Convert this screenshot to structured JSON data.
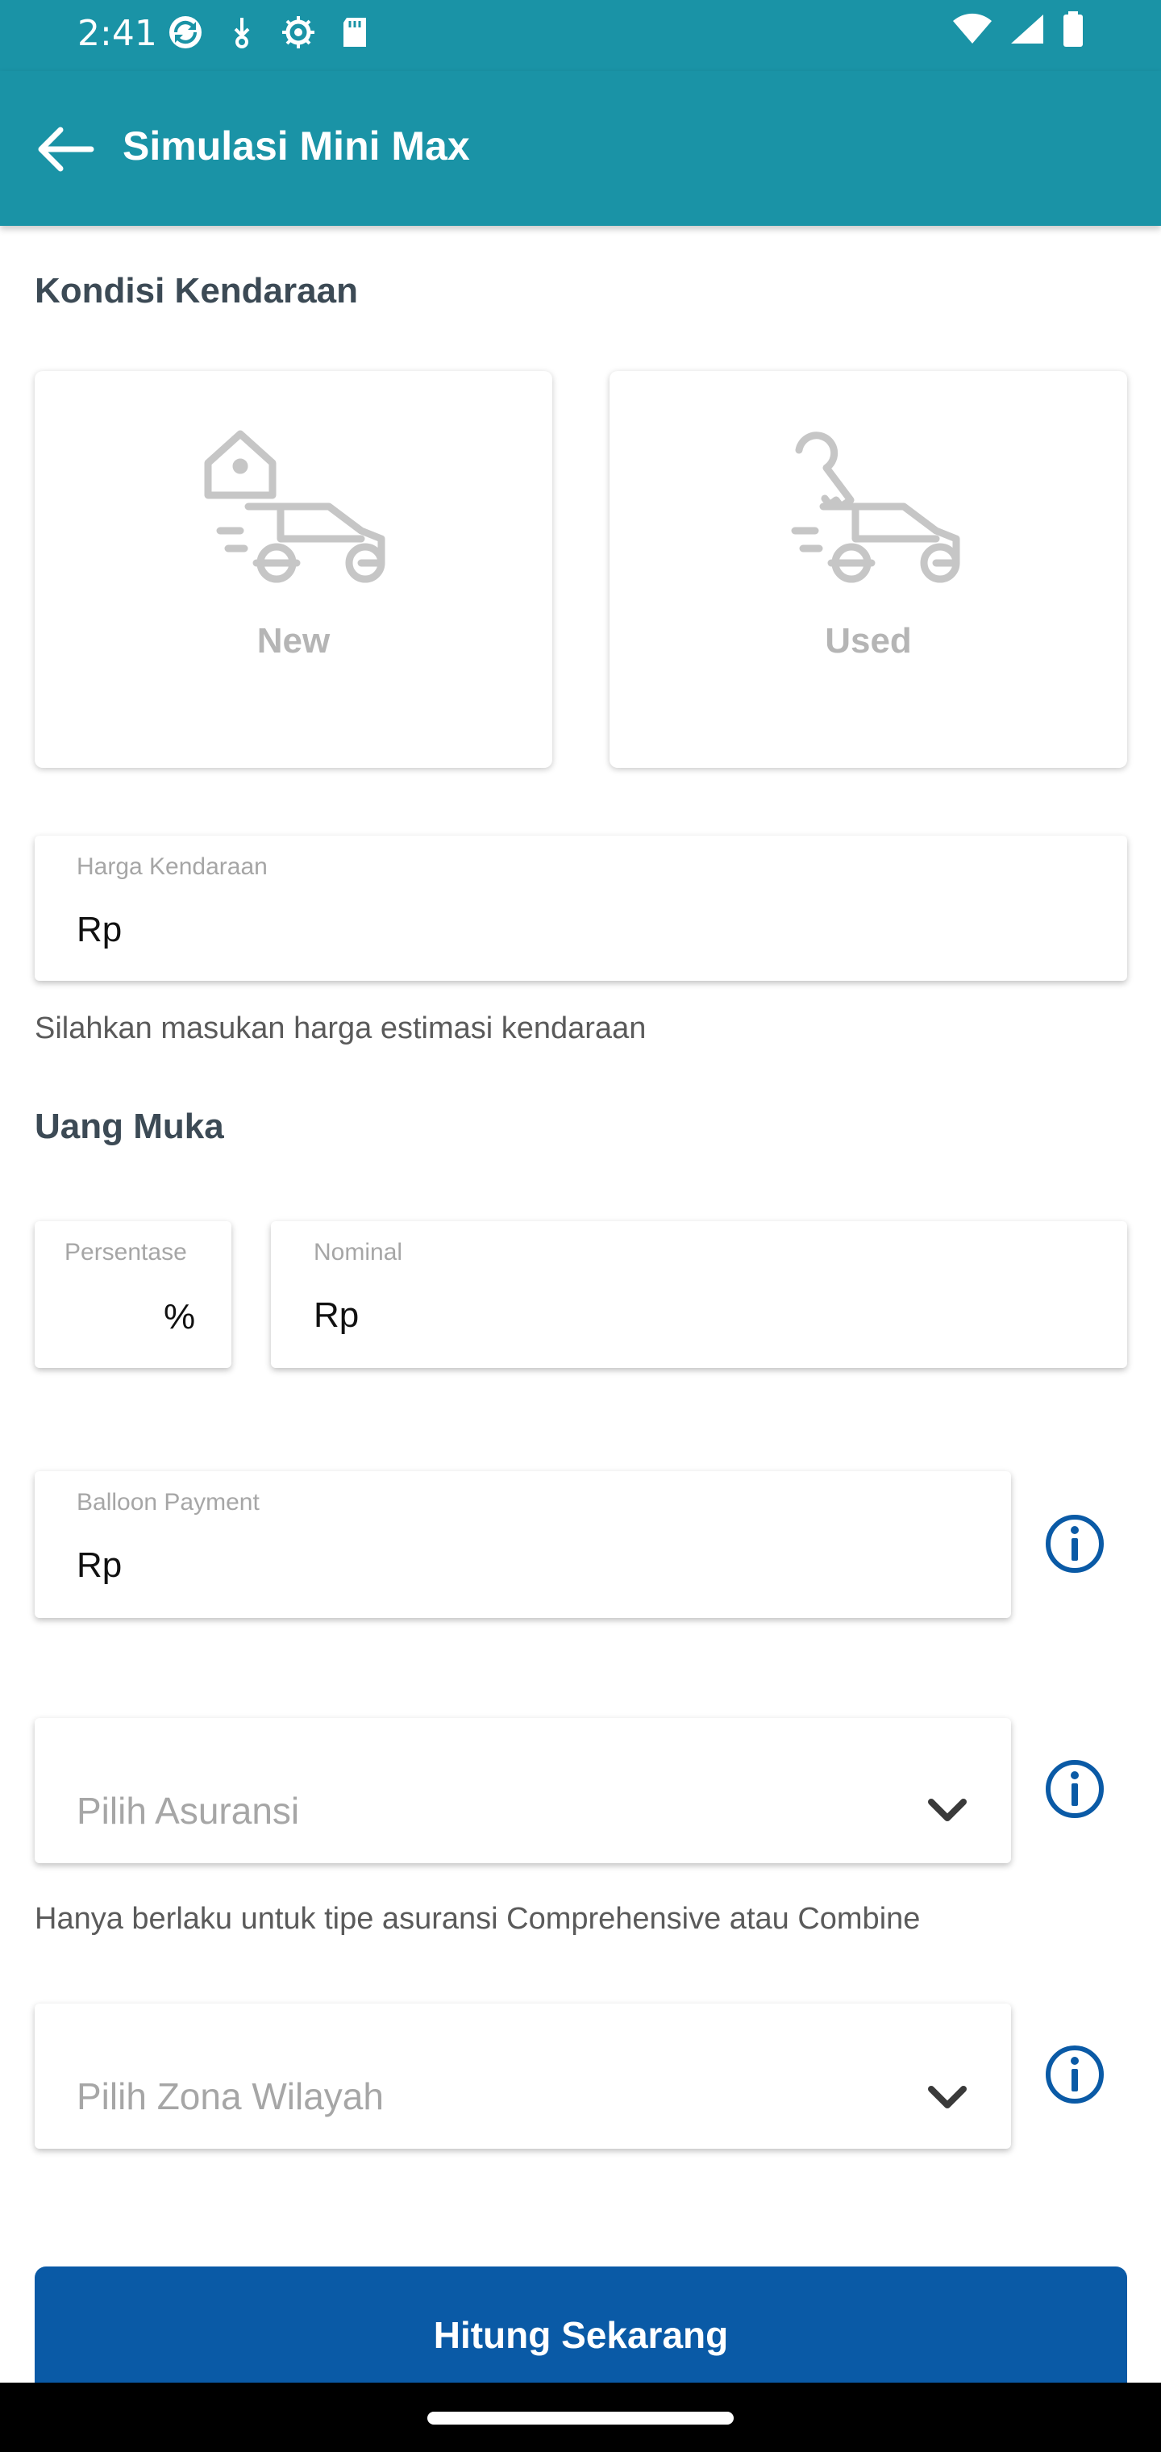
{
  "status_bar": {
    "time": "2:41",
    "notification_icons": [
      "sync-icon",
      "download-icon",
      "settings-icon",
      "sd-card-icon"
    ],
    "system_icons": [
      "wifi-icon",
      "signal-icon",
      "battery-icon"
    ]
  },
  "app_bar": {
    "title": "Simulasi Mini Max",
    "back_icon": "back-arrow-icon",
    "color": "#1a93a6"
  },
  "kondisi": {
    "title": "Kondisi Kendaraan",
    "options": [
      {
        "label": "New",
        "icon": "car-tag-icon"
      },
      {
        "label": "Used",
        "icon": "car-key-icon"
      }
    ]
  },
  "harga": {
    "label": "Harga Kendaraan",
    "prefix": "Rp",
    "helper": "Silahkan masukan harga estimasi kendaraan"
  },
  "uang_muka": {
    "title": "Uang Muka",
    "persentase_label": "Persentase",
    "persentase_suffix": "%",
    "nominal_label": "Nominal",
    "nominal_prefix": "Rp"
  },
  "balloon": {
    "label": "Balloon Payment",
    "prefix": "Rp",
    "info_icon": "info-icon"
  },
  "asuransi": {
    "placeholder": "Pilih Asuransi",
    "helper": "Hanya berlaku untuk tipe asuransi Comprehensive atau Combine",
    "info_icon": "info-icon"
  },
  "zona": {
    "placeholder": "Pilih Zona Wilayah",
    "info_icon": "info-icon"
  },
  "cta": {
    "label": "Hitung Sekarang",
    "color": "#0a5aa6"
  },
  "accent_color": "#0a5aa6"
}
